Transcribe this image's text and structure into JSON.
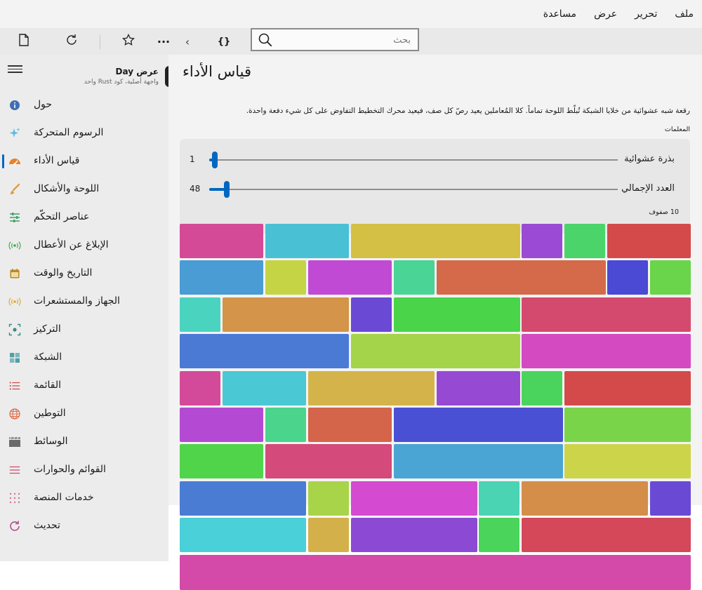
{
  "menu": [
    "ملف",
    "تحرير",
    "عرض",
    "مساعدة"
  ],
  "toolbar": {
    "new_icon": "document-icon",
    "refresh_icon": "refresh-icon",
    "favorite_icon": "star-icon",
    "more_label": "···",
    "back_label": "‹",
    "code_label": "{}",
    "search_placeholder": "بحث",
    "search_icon": "search-icon"
  },
  "sidebar": {
    "title": "عرض Day",
    "subtitle": "واجهة أصلية، كود Rust واحد",
    "items": [
      {
        "label": "حول",
        "icon": "info-icon",
        "color": "#3f6fb5"
      },
      {
        "label": "الرسوم المتحركة",
        "icon": "sparkle-icon",
        "color": "#5fb8e8"
      },
      {
        "label": "قياس الأداء",
        "icon": "speedometer-icon",
        "color": "#e8822c",
        "active": true
      },
      {
        "label": "اللوحة والأشكال",
        "icon": "brush-icon",
        "color": "#e89a3c"
      },
      {
        "label": "عناصر التحكّم",
        "icon": "sliders-icon",
        "color": "#3fa06a"
      },
      {
        "label": "الإبلاغ عن الأعطال",
        "icon": "broadcast-icon",
        "color": "#3fa84e"
      },
      {
        "label": "التاريخ والوقت",
        "icon": "calendar-icon",
        "color": "#b8892c"
      },
      {
        "label": "الجهاز والمستشعرات",
        "icon": "sensor-icon",
        "color": "#e0a82c"
      },
      {
        "label": "التركيز",
        "icon": "focus-icon",
        "color": "#3a8a8a"
      },
      {
        "label": "الشبكة",
        "icon": "grid-icon",
        "color": "#4ea0a8"
      },
      {
        "label": "القائمة",
        "icon": "list-icon",
        "color": "#d04848"
      },
      {
        "label": "التوطين",
        "icon": "globe-icon",
        "color": "#e06a4a"
      },
      {
        "label": "الوسائط",
        "icon": "clapper-icon",
        "color": "#6a6a6a"
      },
      {
        "label": "القوائم والحوارات",
        "icon": "menu-lines-icon",
        "color": "#d04868"
      },
      {
        "label": "خدمات المنصة",
        "icon": "dots-grid-icon",
        "color": "#d07890"
      },
      {
        "label": "تحديث",
        "icon": "update-icon",
        "color": "#b0508a"
      }
    ]
  },
  "main": {
    "title": "قياس الأداء",
    "description": "رقعة شبه عشوائية من خلايا الشبكة تُبلّط اللوحة تماماً. كلا المُعاملين يعيد رصّ كل صف، فيعيد محرك التخطيط التفاوض على كل شيء دفعة واحدة.",
    "params_label": "المعلمات",
    "sliders": [
      {
        "label": "بذرة عشوائية",
        "value": "1",
        "fraction": 0.0
      },
      {
        "label": "العدد الإجمالي",
        "value": "48",
        "fraction": 0.03
      }
    ],
    "rows_label": "10 صفوف"
  },
  "grid_rows": [
    [
      [
        2,
        "#d44a96"
      ],
      [
        2,
        "#4ac0d4"
      ],
      [
        4,
        "#d4c044"
      ],
      [
        1,
        "#9a4ad4"
      ],
      [
        1,
        "#4ad46a"
      ],
      [
        2,
        "#d44a4a"
      ]
    ],
    [
      [
        2,
        "#4a9cd4"
      ],
      [
        1,
        "#c4d444"
      ],
      [
        2,
        "#c04ad4"
      ],
      [
        1,
        "#4ad496"
      ],
      [
        4,
        "#d46a4a"
      ],
      [
        1,
        "#4a4ad4"
      ],
      [
        1,
        "#6ad44a"
      ]
    ],
    [
      [
        1,
        "#4ad4c0"
      ],
      [
        3,
        "#d4944a"
      ],
      [
        1,
        "#6a4ad4"
      ],
      [
        3,
        "#4ad44a"
      ],
      [
        4,
        "#d44a6e"
      ]
    ],
    [
      [
        4,
        "#4a7ad4"
      ],
      [
        4,
        "#a4d44a"
      ],
      [
        4,
        "#d44ac0"
      ]
    ],
    [
      [
        1,
        "#d44a9a"
      ],
      [
        2,
        "#4ac8d4"
      ],
      [
        3,
        "#d4b44a"
      ],
      [
        2,
        "#964ad4"
      ],
      [
        1,
        "#4ad45e"
      ],
      [
        3,
        "#d44a4a"
      ]
    ],
    [
      [
        2,
        "#b44ad4"
      ],
      [
        1,
        "#4ad48c"
      ],
      [
        2,
        "#d4644a"
      ],
      [
        4,
        "#4a50d4"
      ],
      [
        3,
        "#7ad44a"
      ]
    ],
    [
      [
        2,
        "#50d44a"
      ],
      [
        3,
        "#d44a7a"
      ],
      [
        4,
        "#4aa4d4"
      ],
      [
        3,
        "#ccd44a"
      ]
    ],
    [
      [
        3,
        "#4a7cd4"
      ],
      [
        1,
        "#a8d44a"
      ],
      [
        3,
        "#d44ad0"
      ],
      [
        1,
        "#4ad4b4"
      ],
      [
        3,
        "#d48e4a"
      ],
      [
        1,
        "#6a4ad4"
      ]
    ],
    [
      [
        3,
        "#4ad0d8"
      ],
      [
        1,
        "#d4b04a"
      ],
      [
        3,
        "#8c4ad4"
      ],
      [
        1,
        "#4ad45c"
      ],
      [
        4,
        "#d4485a"
      ]
    ],
    [
      [
        12,
        "#d44aa8"
      ]
    ]
  ]
}
